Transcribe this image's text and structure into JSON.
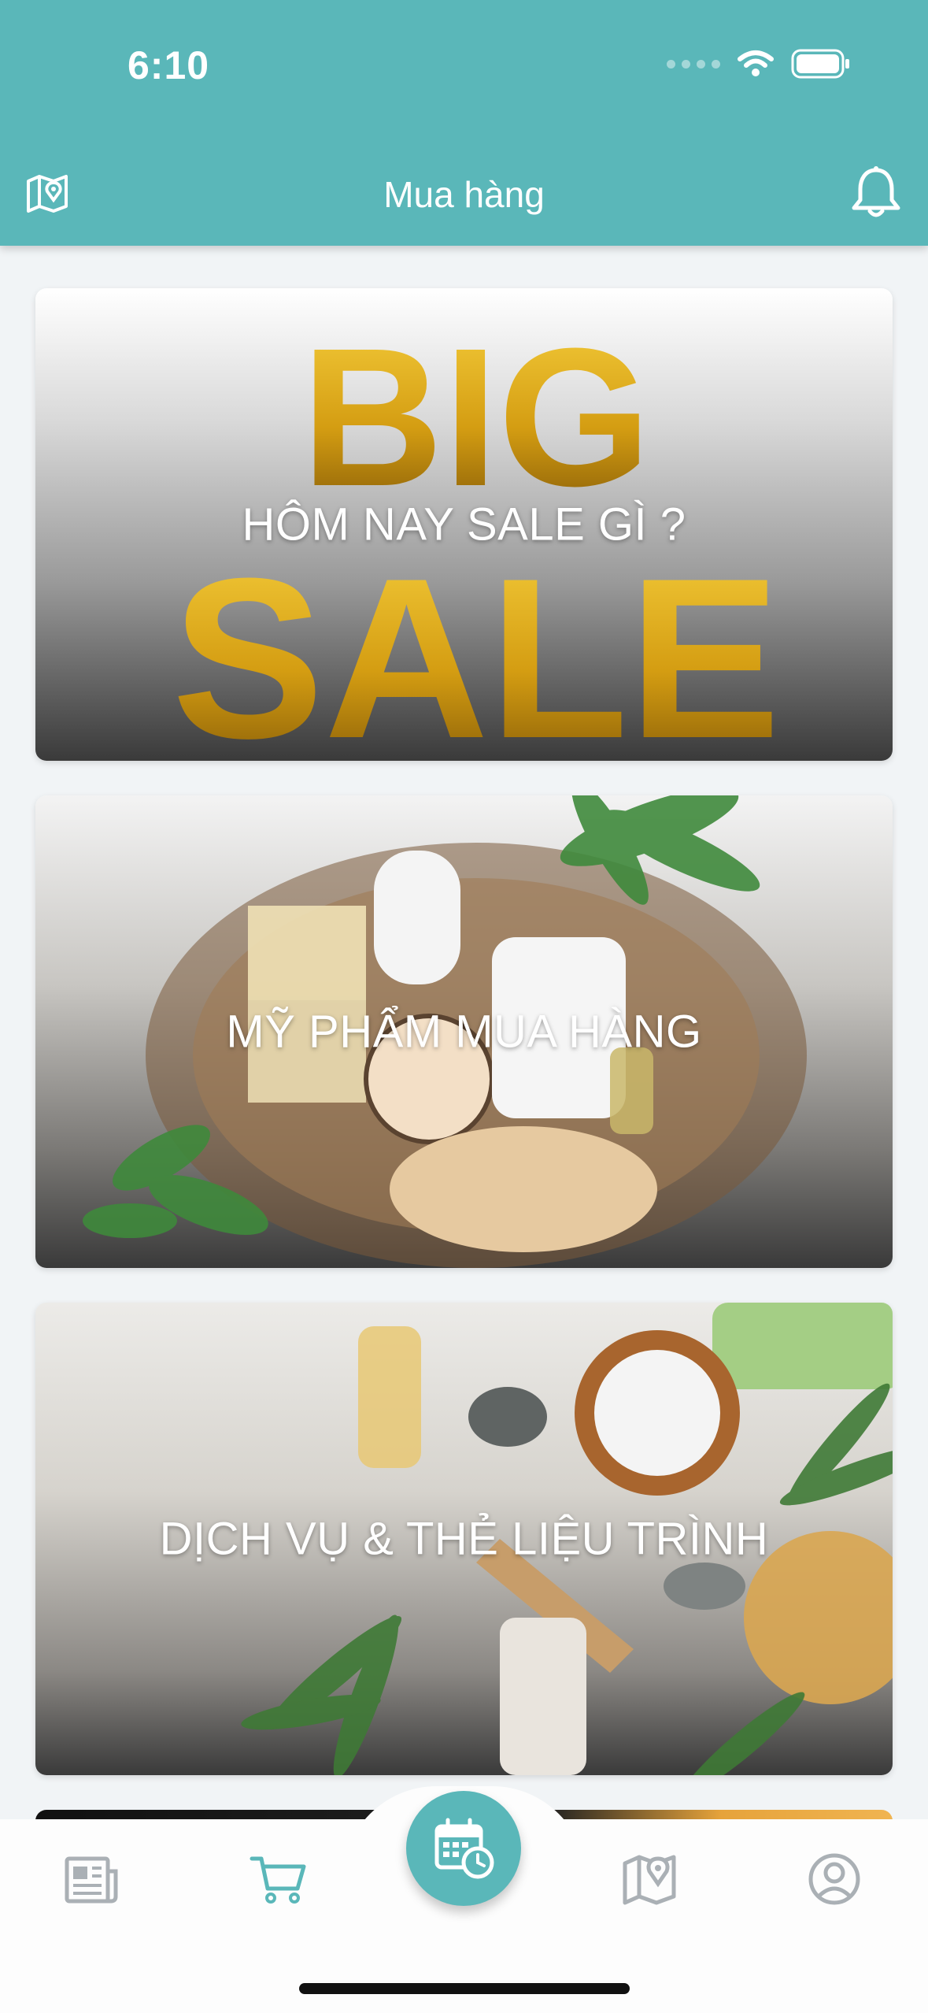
{
  "status_bar": {
    "time": "6:10"
  },
  "header": {
    "title": "Mua hàng"
  },
  "banners": [
    {
      "label": "HÔM NAY SALE GÌ ?",
      "art_text": [
        "BIG",
        "SALE"
      ]
    },
    {
      "label": "MỸ PHẨM MUA HÀNG"
    },
    {
      "label": "DỊCH VỤ & THẺ LIỆU TRÌNH"
    }
  ],
  "tabbar": {
    "items": [
      {
        "icon": "newspaper-icon",
        "active": false
      },
      {
        "icon": "cart-icon",
        "active": true
      },
      {
        "icon": "calendar-clock-icon",
        "center": true
      },
      {
        "icon": "map-pin-icon",
        "active": false
      },
      {
        "icon": "profile-icon",
        "active": false
      }
    ]
  },
  "colors": {
    "primary": "#5ab7b9",
    "inactive_icon": "#aab0b5",
    "background": "#f1f4f6"
  }
}
